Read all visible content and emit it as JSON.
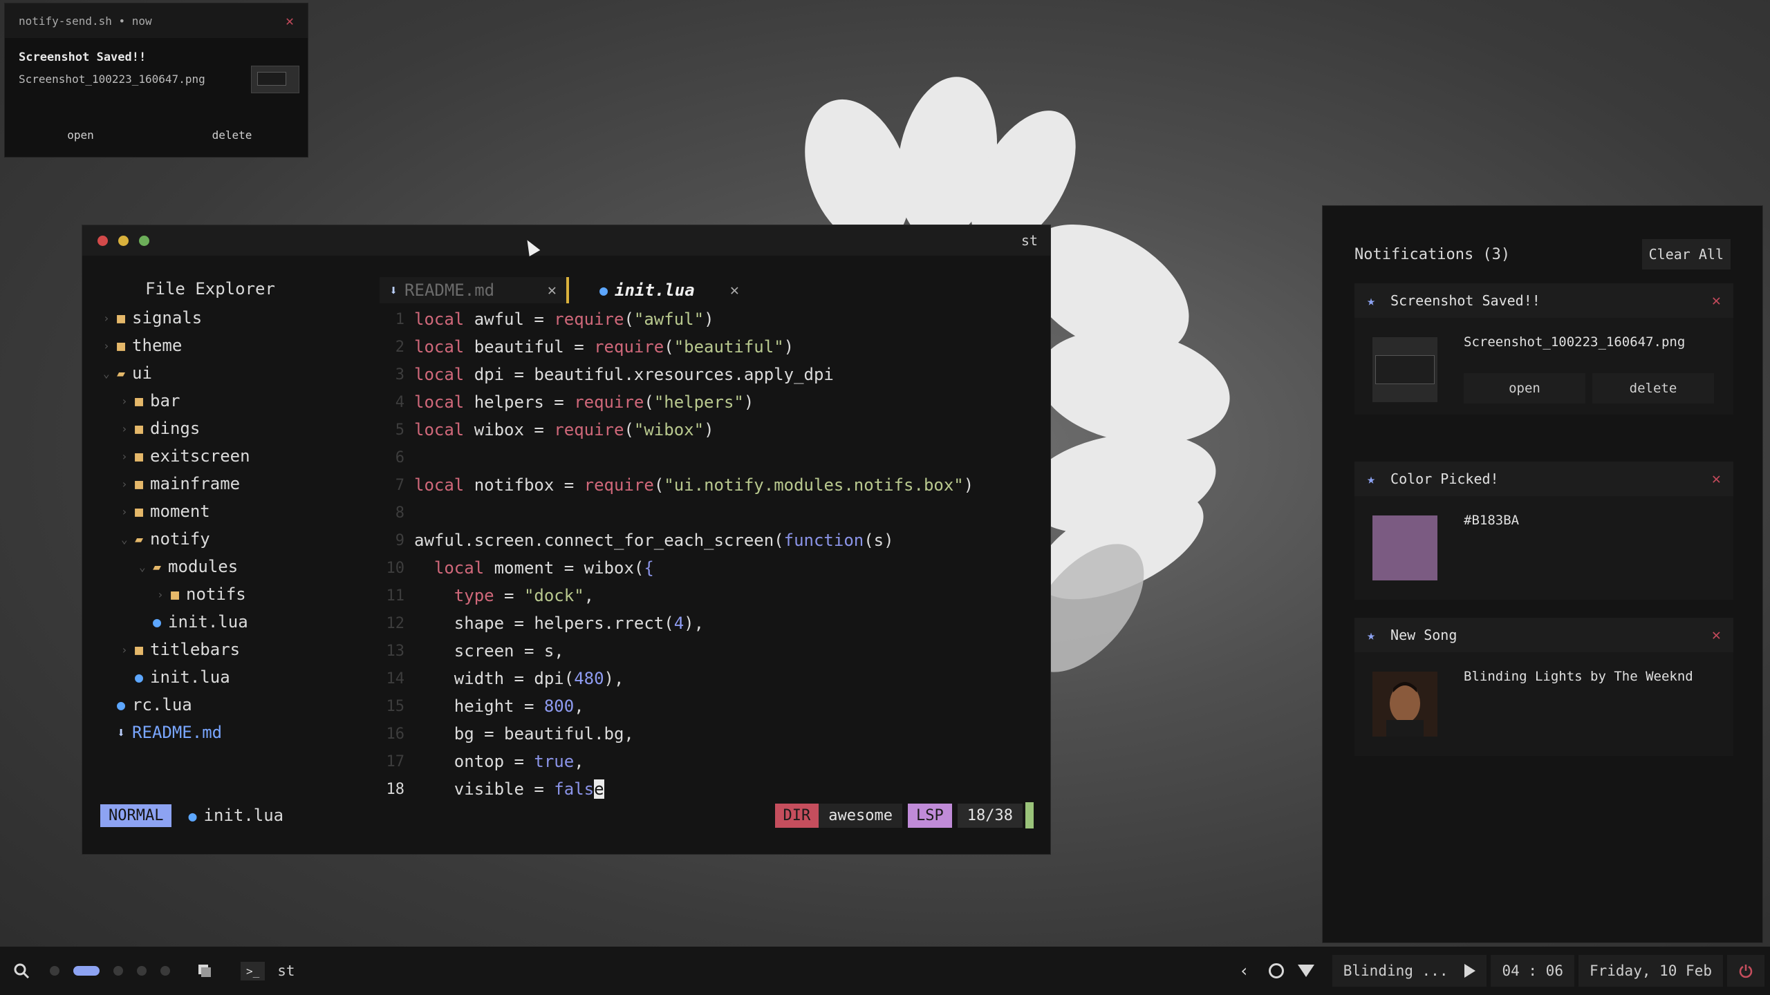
{
  "popup": {
    "header": "notify-send.sh • now",
    "title": "Screenshot Saved!!",
    "text": "Screenshot_100223_160647.png",
    "open": "open",
    "delete": "delete"
  },
  "editor": {
    "window_title": "st",
    "explorer_title": "File Explorer",
    "tree": [
      {
        "label": "signals",
        "icon": "folder-icon"
      },
      {
        "label": "theme",
        "icon": "folder-icon"
      },
      {
        "label": "ui",
        "icon": "folder-open-icon"
      },
      {
        "label": "bar",
        "icon": "folder-icon"
      },
      {
        "label": "dings",
        "icon": "folder-icon"
      },
      {
        "label": "exitscreen",
        "icon": "folder-icon"
      },
      {
        "label": "mainframe",
        "icon": "folder-icon"
      },
      {
        "label": "moment",
        "icon": "folder-icon"
      },
      {
        "label": "notify",
        "icon": "folder-open-icon"
      },
      {
        "label": "modules",
        "icon": "folder-open-icon"
      },
      {
        "label": "notifs",
        "icon": "folder-icon"
      },
      {
        "label": "init.lua",
        "icon": "lua-icon"
      },
      {
        "label": "titlebars",
        "icon": "folder-icon"
      },
      {
        "label": "init.lua",
        "icon": "lua-icon"
      },
      {
        "label": "rc.lua",
        "icon": "lua-icon"
      },
      {
        "label": "README.md",
        "icon": "markdown-icon"
      }
    ],
    "tabs": [
      {
        "label": "README.md"
      },
      {
        "label": "init.lua"
      }
    ],
    "line_numbers": [
      "1",
      "2",
      "3",
      "4",
      "5",
      "6",
      "7",
      "8",
      "9",
      "10",
      "11",
      "12",
      "13",
      "14",
      "15",
      "16",
      "17",
      "18"
    ],
    "statusline": {
      "mode": "NORMAL",
      "file": "init.lua",
      "dir_label": "DIR",
      "dir_value": "awesome",
      "lsp": "LSP",
      "position": "18/38"
    }
  },
  "notification_center": {
    "title": "Notifications (3)",
    "clear_all": "Clear All",
    "cards": [
      {
        "title": "Screenshot Saved!!",
        "text": "Screenshot_100223_160647.png",
        "open": "open",
        "delete": "delete"
      },
      {
        "title": "Color Picked!",
        "text": "#B183BA",
        "swatch": "#7b5b82"
      },
      {
        "title": "New Song",
        "text": "Blinding Lights by The Weeknd"
      }
    ]
  },
  "taskbar": {
    "app": "st",
    "music": "Blinding ...",
    "time": "04 : 06",
    "date": "Friday, 10 Feb"
  },
  "colors": {
    "accent_blue": "#8da3f2",
    "accent_red": "#c54e5d",
    "accent_purple": "#c08bd8",
    "accent_green": "#9ac37a"
  }
}
